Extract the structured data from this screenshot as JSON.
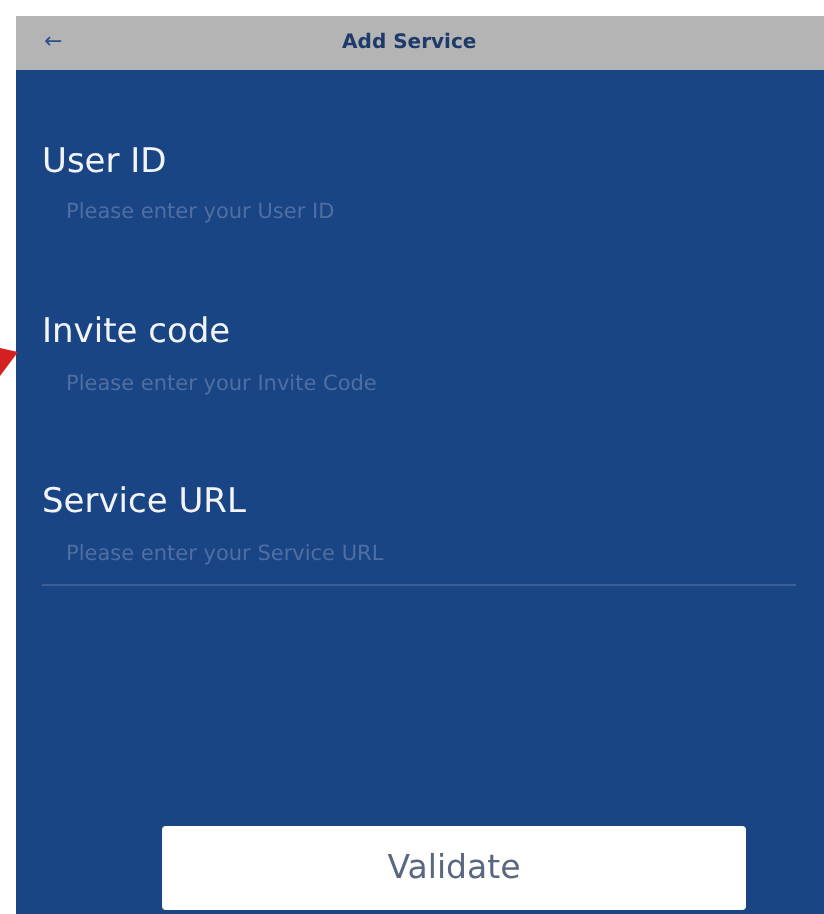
{
  "header": {
    "back_icon": "←",
    "title": "Add Service"
  },
  "fields": [
    {
      "label": "User ID",
      "placeholder": "Please enter your User ID",
      "underline": false
    },
    {
      "label": "Invite code",
      "placeholder": "Please enter your Invite Code",
      "underline": false
    },
    {
      "label": "Service URL",
      "placeholder": "Please enter your Service URL",
      "underline": true
    }
  ],
  "buttons": [
    "Validate"
  ]
}
